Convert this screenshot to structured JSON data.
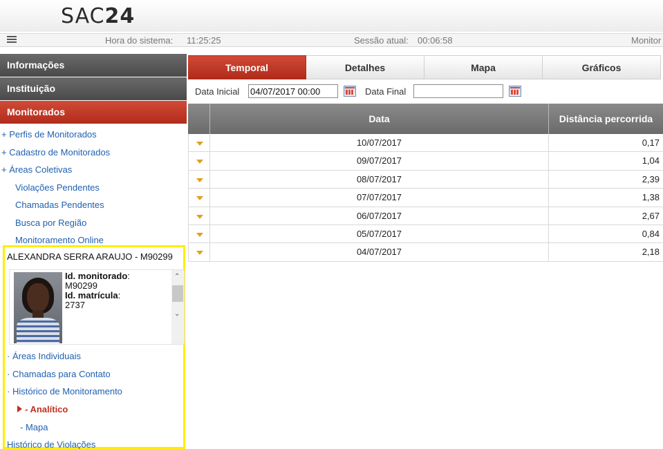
{
  "header": {
    "logo_letters": "SAC",
    "logo_number": "24",
    "clock_label": "Hora do sistema:",
    "clock_value": "11:25:25",
    "session_label": "Sessão atual:",
    "session_value": "00:06:58",
    "monitor_label": "Monitor"
  },
  "sidebar": {
    "sections": {
      "informacoes": "Informações",
      "instituicao": "Instituição",
      "monitorados": "Monitorados"
    },
    "links": [
      "+ Perfis de Monitorados",
      "+ Cadastro de Monitorados",
      "+ Áreas Coletivas",
      "Violações Pendentes",
      "Chamadas Pendentes",
      "Busca por Região",
      "Monitoramento Online"
    ],
    "person": {
      "name": "ALEXANDRA SERRA ARAUJO - M90299",
      "id_monitorado_label": "Id. monitorado",
      "id_monitorado_value": "M90299",
      "id_matricula_label": "Id. matrícula",
      "id_matricula_value": "2737"
    },
    "sub_links": {
      "areas_individuais": "Áreas Individuais",
      "chamadas_contato": "Chamadas para Contato",
      "historico_monitoramento": "Histórico de Monitoramento",
      "analitico": "- Analítico",
      "mapa": "- Mapa",
      "historico_violacoes": "Histórico de Violações"
    }
  },
  "tabs": [
    "Temporal",
    "Detalhes",
    "Mapa",
    "Gráficos"
  ],
  "active_tab": "Temporal",
  "filter": {
    "data_inicial_label": "Data Inicial",
    "data_inicial_value": "04/07/2017 00:00",
    "data_final_label": "Data Final",
    "data_final_value": ""
  },
  "grid": {
    "columns": [
      "Data",
      "Distância percorrida"
    ],
    "rows": [
      {
        "data": "10/07/2017",
        "distancia": "0,17"
      },
      {
        "data": "09/07/2017",
        "distancia": "1,04"
      },
      {
        "data": "08/07/2017",
        "distancia": "2,39"
      },
      {
        "data": "07/07/2017",
        "distancia": "1,38"
      },
      {
        "data": "06/07/2017",
        "distancia": "2,67"
      },
      {
        "data": "05/07/2017",
        "distancia": "0,84"
      },
      {
        "data": "04/07/2017",
        "distancia": "2,18"
      }
    ]
  },
  "colors": {
    "accent_red": "#c0301e",
    "link_blue": "#2060b0",
    "highlight_yellow": "#ffee00"
  }
}
